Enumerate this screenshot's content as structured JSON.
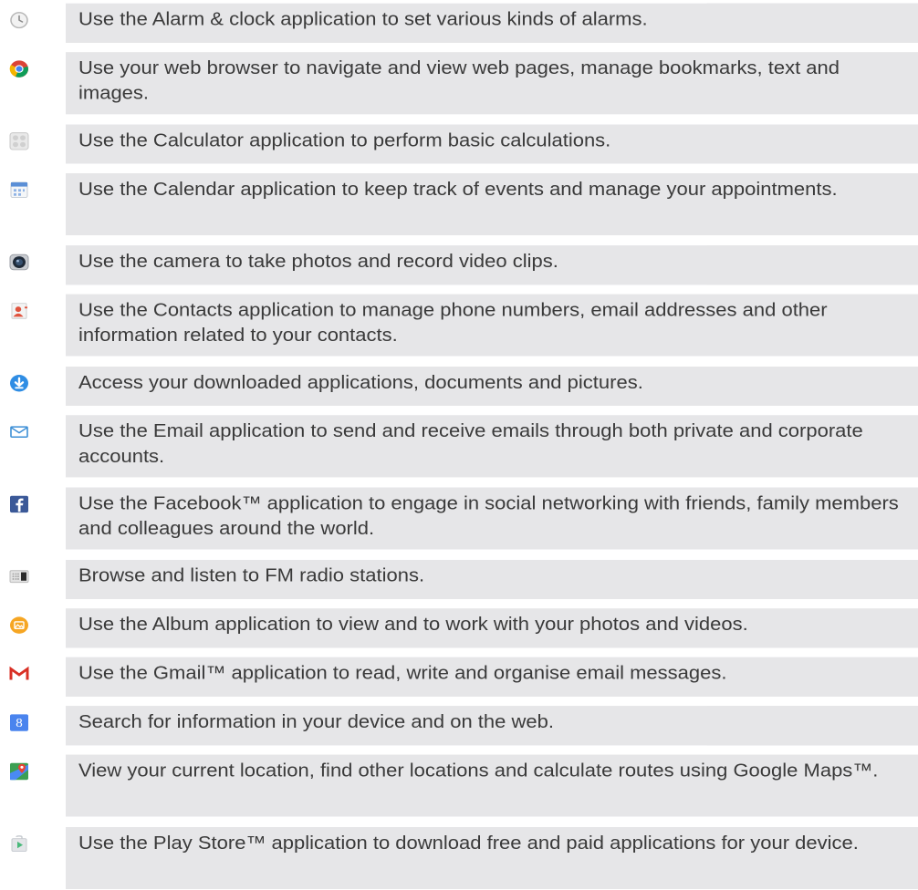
{
  "items": [
    {
      "icon": "alarm-clock-icon",
      "text": "Use the Alarm & clock application to set various kinds of alarms."
    },
    {
      "icon": "browser-icon",
      "text": "Use your web browser to navigate and view web pages, manage bookmarks, text and images."
    },
    {
      "icon": "calculator-icon",
      "text": "Use the Calculator application to perform basic calculations."
    },
    {
      "icon": "calendar-icon",
      "text": "Use the Calendar application to keep track of events and manage your appointments."
    },
    {
      "icon": "camera-icon",
      "text": "Use the camera to take photos and record video clips."
    },
    {
      "icon": "contacts-icon",
      "text": "Use the Contacts application to manage phone numbers, email addresses and other information related to your contacts."
    },
    {
      "icon": "download-icon",
      "text": "Access your downloaded applications, documents and pictures."
    },
    {
      "icon": "email-icon",
      "text": "Use the Email application to send and receive emails through both private and corporate accounts."
    },
    {
      "icon": "facebook-icon",
      "text": "Use the Facebook™ application to engage in social networking with friends, family members and colleagues around the world."
    },
    {
      "icon": "fm-radio-icon",
      "text": "Browse and listen to FM radio stations."
    },
    {
      "icon": "album-icon",
      "text": "Use the Album application to view and to work with your photos and videos."
    },
    {
      "icon": "gmail-icon",
      "text": "Use the Gmail™ application to read, write and organise email messages."
    },
    {
      "icon": "google-search-icon",
      "text": "Search for information in your device and on the web."
    },
    {
      "icon": "maps-icon",
      "text": "View your current location, find other locations and calculate routes using Google Maps™."
    },
    {
      "icon": "play-store-icon",
      "text": "Use the Play Store™ application to download free and paid applications for your device."
    }
  ]
}
